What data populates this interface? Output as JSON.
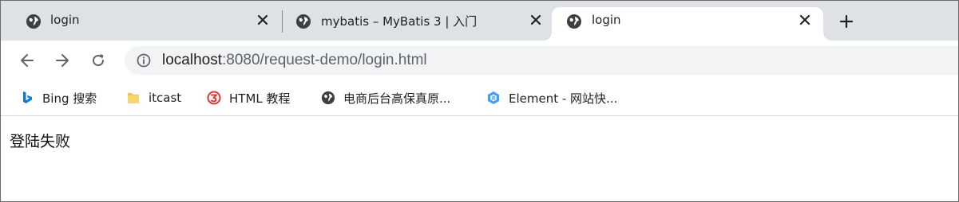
{
  "tabs": [
    {
      "title": "login",
      "icon": "globe-icon",
      "active": false
    },
    {
      "title": "mybatis – MyBatis 3 | 入门",
      "icon": "globe-icon",
      "active": false
    },
    {
      "title": "login",
      "icon": "globe-icon",
      "active": true
    }
  ],
  "tabstrip": {
    "new_tab_icon": "plus-icon",
    "close_icon": "close-icon"
  },
  "toolbar": {
    "back_icon": "arrow-left-icon",
    "forward_icon": "arrow-right-icon",
    "reload_icon": "reload-icon",
    "site_info_icon": "info-icon",
    "url_host": "localhost",
    "url_rest": ":8080/request-demo/login.html"
  },
  "bookmarks": [
    {
      "label": "Bing 搜索",
      "icon": "bing-icon"
    },
    {
      "label": "itcast",
      "icon": "folder-icon"
    },
    {
      "label": "HTML 教程",
      "icon": "runoob-icon"
    },
    {
      "label": "电商后台高保真原...",
      "icon": "globe-icon"
    },
    {
      "label": "Element - 网站快...",
      "icon": "element-icon"
    }
  ],
  "page": {
    "message": "登陆失败"
  },
  "colors": {
    "tabstrip_bg": "#dee1e6",
    "omnibox_bg": "#f1f3f4",
    "bing_blue": "#0a7bd6",
    "folder_yellow": "#f6c343",
    "runoob_red": "#e0372f",
    "element_blue": "#409eff"
  }
}
